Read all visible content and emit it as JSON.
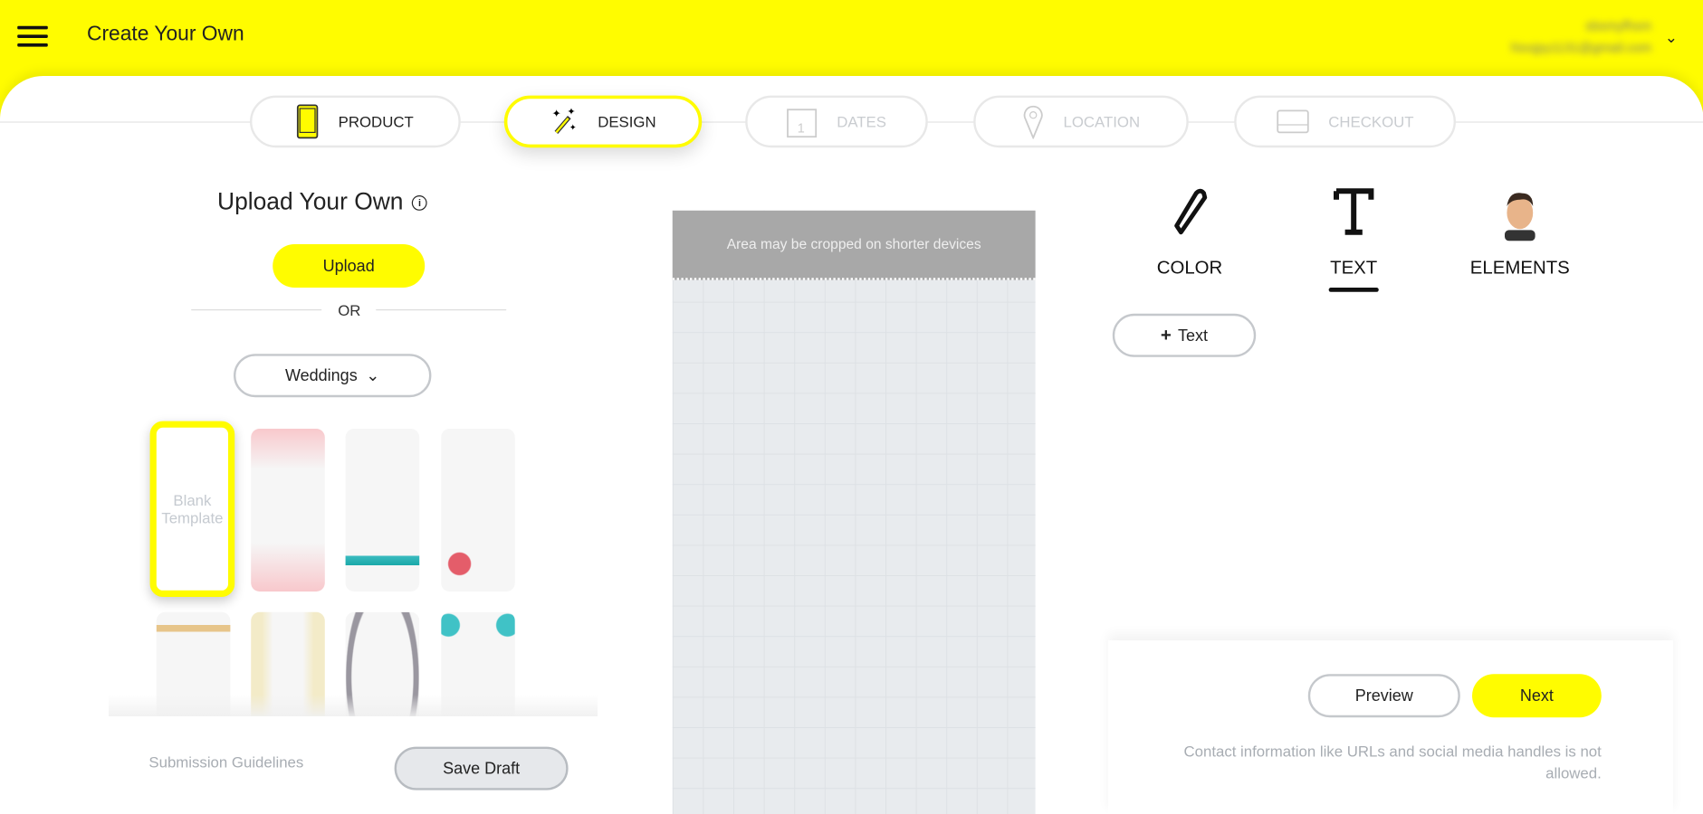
{
  "header": {
    "title": "Create Your Own",
    "user_name": "sbsmyfhsm",
    "user_email": "hixxjpy1131@gmail.com"
  },
  "steps": [
    {
      "label": "PRODUCT",
      "icon": "phone-icon",
      "state": "done"
    },
    {
      "label": "DESIGN",
      "icon": "magic-wand-icon",
      "state": "active"
    },
    {
      "label": "DATES",
      "icon": "calendar-icon",
      "state": "disabled"
    },
    {
      "label": "LOCATION",
      "icon": "location-pin-icon",
      "state": "disabled"
    },
    {
      "label": "CHECKOUT",
      "icon": "card-icon",
      "state": "disabled"
    }
  ],
  "left": {
    "title": "Upload Your Own",
    "upload": "Upload",
    "or": "OR",
    "category": "Weddings",
    "blank_template": "Blank Template",
    "submission_guidelines": "Submission Guidelines",
    "save_draft": "Save Draft"
  },
  "canvas": {
    "crop_notice": "Area may be cropped on shorter devices"
  },
  "tools": {
    "tabs": [
      {
        "label": "COLOR",
        "icon": "pen-icon"
      },
      {
        "label": "TEXT",
        "icon": "text-icon",
        "active": true
      },
      {
        "label": "ELEMENTS",
        "icon": "bitmoji-icon"
      }
    ],
    "add_text": "Text"
  },
  "footer": {
    "preview": "Preview",
    "next": "Next",
    "notice": "Contact information like URLs and social media handles is not allowed."
  },
  "colors": {
    "brand": "#fffc00"
  }
}
